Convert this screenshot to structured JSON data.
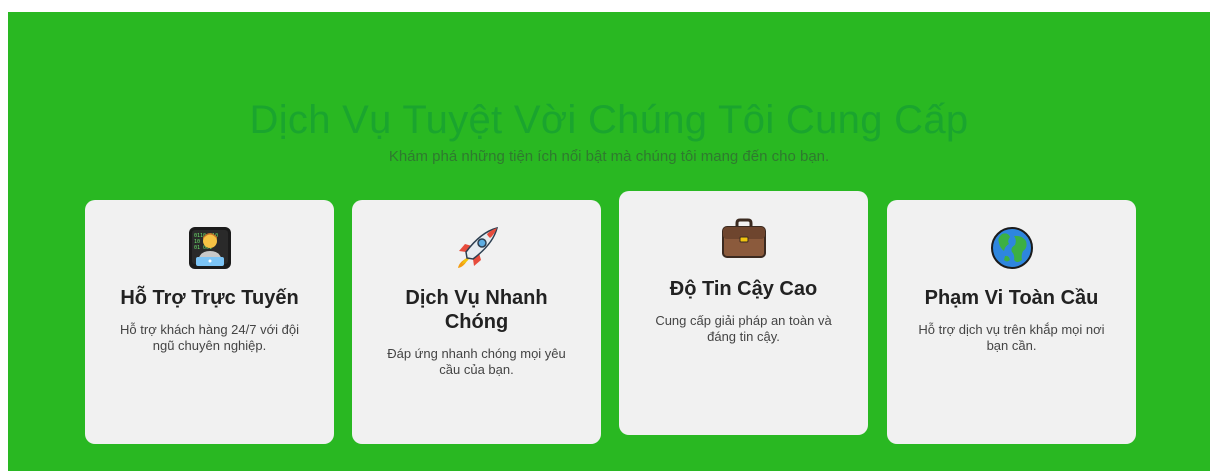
{
  "section": {
    "title": "Dịch Vụ Tuyệt Vời Chúng Tôi Cung Cấp",
    "subtitle": "Khám phá những tiện ích nổi bật mà chúng tôi mang đến cho bạn."
  },
  "cards": [
    {
      "icon": "technologist-icon",
      "title": "Hỗ Trợ Trực Tuyến",
      "description": "Hỗ trợ khách hàng 24/7 với đội ngũ chuyên nghiệp."
    },
    {
      "icon": "rocket-icon",
      "title": "Dịch Vụ Nhanh Chóng",
      "description": "Đáp ứng nhanh chóng mọi yêu cầu của bạn."
    },
    {
      "icon": "briefcase-icon",
      "title": "Độ Tin Cậy Cao",
      "description": "Cung cấp giải pháp an toàn và đáng tin cậy."
    },
    {
      "icon": "globe-icon",
      "title": "Phạm Vi Toàn Cầu",
      "description": "Hỗ trợ dịch vụ trên khắp mọi nơi bạn cần."
    }
  ],
  "colors": {
    "background": "#29b822",
    "title": "#1aa52e",
    "subtitle": "#2f7a2f",
    "card": "#f1f1f1"
  }
}
